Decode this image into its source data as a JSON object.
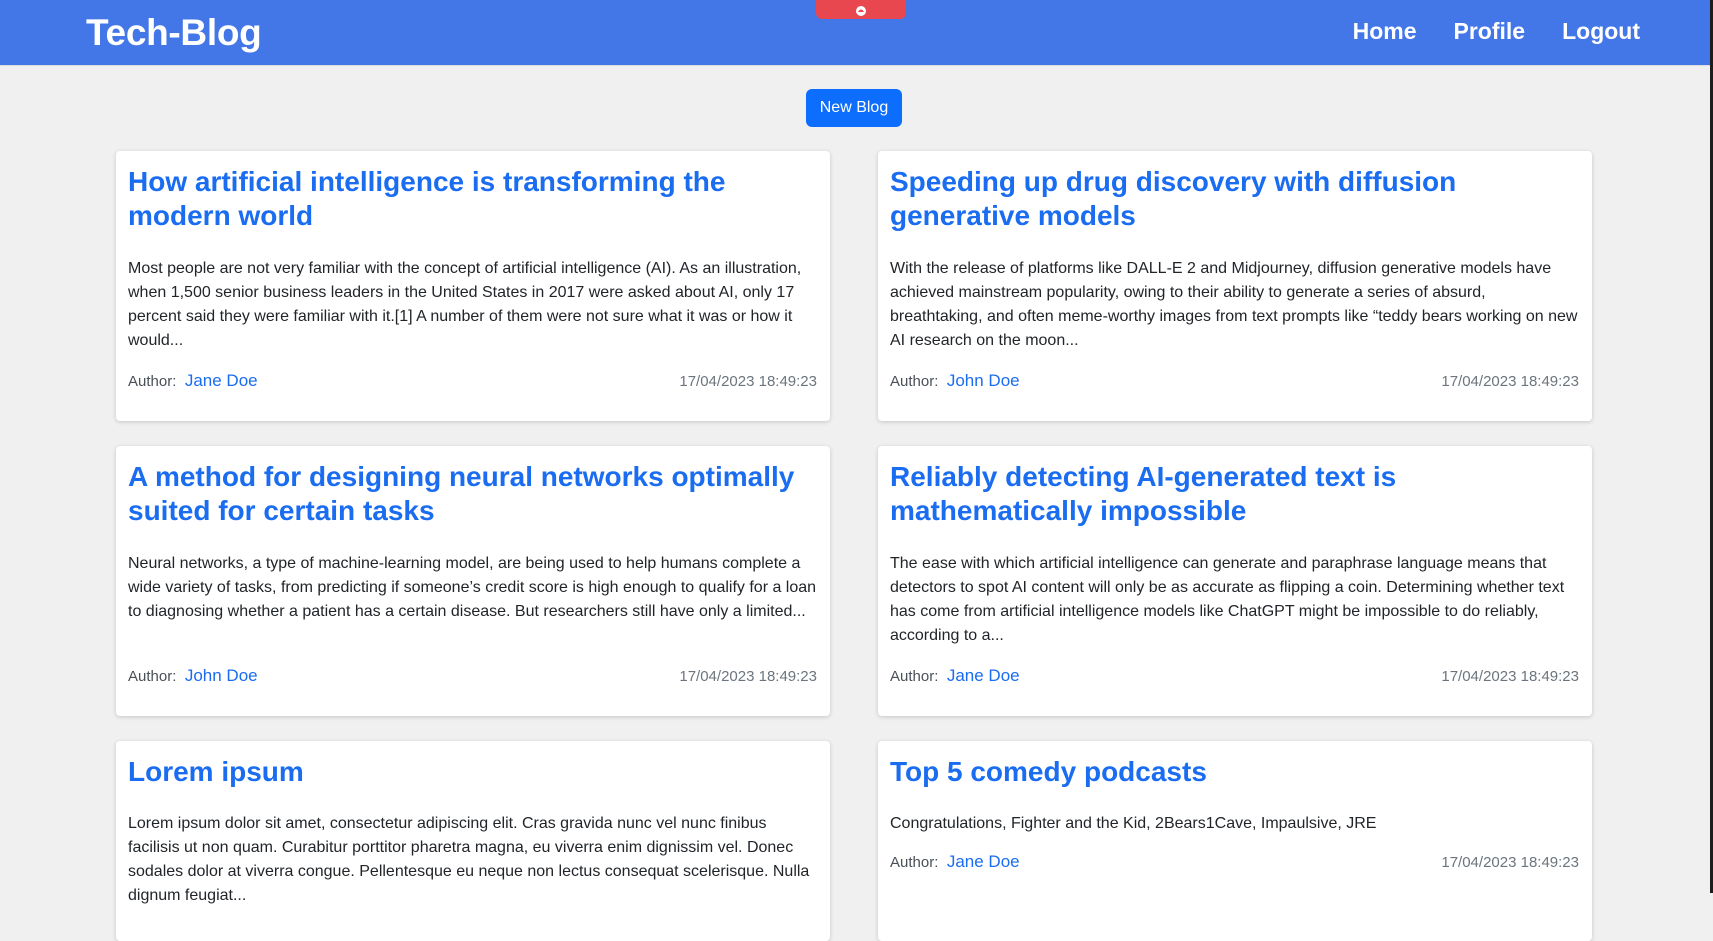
{
  "brand": "Tech-Blog",
  "nav": [
    "Home",
    "Profile",
    "Logout"
  ],
  "new_blog_label": "New Blog",
  "author_prefix": "Author:",
  "posts": [
    {
      "title": "How artificial intelligence is transforming the modern world",
      "excerpt": "Most people are not very familiar with the concept of artificial intelligence (AI). As an illustration, when 1,500 senior business leaders in the United States in 2017 were asked about AI, only 17 percent said they were familiar with it.[1] A number of them were not sure what it was or how it would...",
      "author": "Jane Doe",
      "date": "17/04/2023 18:49:23"
    },
    {
      "title": "Speeding up drug discovery with diffusion generative models",
      "excerpt": "With the release of platforms like DALL-E 2 and Midjourney, diffusion generative models have achieved mainstream popularity, owing to their ability to generate a series of absurd, breathtaking, and often meme-worthy images from text prompts like “teddy bears working on new AI research on the moon...",
      "author": "John Doe",
      "date": "17/04/2023 18:49:23"
    },
    {
      "title": "A method for designing neural networks optimally suited for certain tasks",
      "excerpt": "Neural networks, a type of machine-learning model, are being used to help humans complete a wide variety of tasks, from predicting if someone’s credit score is high enough to qualify for a loan to diagnosing whether a patient has a certain disease. But researchers still have only a limited...",
      "author": "John Doe",
      "date": "17/04/2023 18:49:23"
    },
    {
      "title": "Reliably detecting AI-generated text is mathematically impossible",
      "excerpt": "The ease with which artificial intelligence can generate and paraphrase language means that detectors to spot AI content will only be as accurate as flipping a coin. Determining whether text has come from artificial intelligence models like ChatGPT might be impossible to do reliably, according to a...",
      "author": "Jane Doe",
      "date": "17/04/2023 18:49:23"
    },
    {
      "title": "Lorem ipsum",
      "excerpt": "Lorem ipsum dolor sit amet, consectetur adipiscing elit. Cras gravida nunc vel nunc finibus facilisis ut non quam. Curabitur porttitor pharetra magna, eu viverra enim dignissim vel. Donec sodales dolor at viverra congue. Pellentesque eu neque non lectus consequat scelerisque. Nulla dignum feugiat...",
      "author": "",
      "date": ""
    },
    {
      "title": "Top 5 comedy podcasts",
      "excerpt": "Congratulations, Fighter and the Kid, 2Bears1Cave, Impaulsive, JRE",
      "author": "Jane Doe",
      "date": "17/04/2023 18:49:23"
    }
  ]
}
